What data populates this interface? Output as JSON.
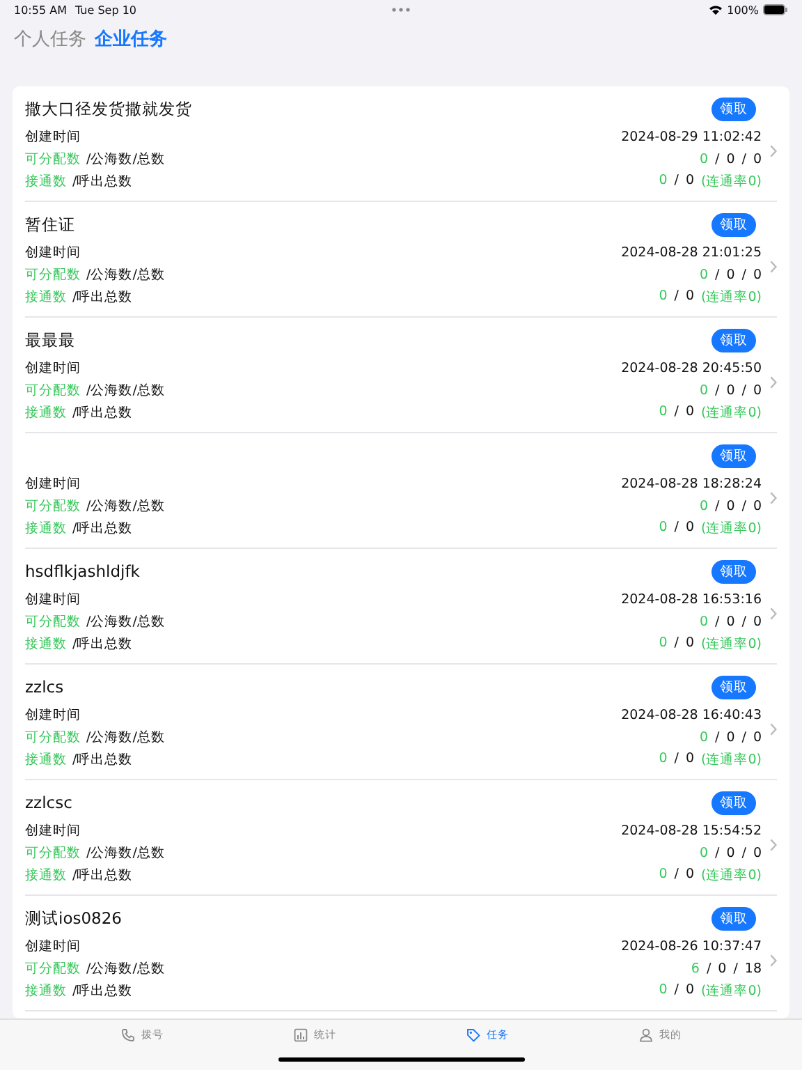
{
  "status_bar": {
    "time": "10:55 AM",
    "date": "Tue Sep 10",
    "battery": "100%"
  },
  "tabs": [
    {
      "label": "个人任务",
      "selected": false
    },
    {
      "label": "企业任务",
      "selected": true
    }
  ],
  "tasks": [
    {
      "title": "撒大口径发货撒就发货",
      "button": "领取",
      "created_label": "创建时间",
      "created_at": "2024-08-29 11:02:42",
      "assign_label": "可分配数",
      "assign_rest": "/公海数/总数",
      "counts": [
        {
          "text": "0",
          "kind": "accent"
        },
        {
          "text": "/",
          "kind": "plain"
        },
        {
          "text": "0",
          "kind": "plain"
        },
        {
          "text": "/",
          "kind": "plain"
        },
        {
          "text": "0",
          "kind": "plain"
        }
      ],
      "connect_label": "接通数",
      "connect_rest": "/呼出总数",
      "calls": [
        {
          "text": "0",
          "kind": "accent"
        },
        {
          "text": "/",
          "kind": "plain"
        },
        {
          "text": "0",
          "kind": "plain"
        },
        {
          "text": "(连通率0)",
          "kind": "accent"
        }
      ]
    },
    {
      "title": "暂住证",
      "button": "领取",
      "created_label": "创建时间",
      "created_at": "2024-08-28 21:01:25",
      "assign_label": "可分配数",
      "assign_rest": "/公海数/总数",
      "counts": [
        {
          "text": "0",
          "kind": "accent"
        },
        {
          "text": "/",
          "kind": "plain"
        },
        {
          "text": "0",
          "kind": "plain"
        },
        {
          "text": "/",
          "kind": "plain"
        },
        {
          "text": "0",
          "kind": "plain"
        }
      ],
      "connect_label": "接通数",
      "connect_rest": "/呼出总数",
      "calls": [
        {
          "text": "0",
          "kind": "accent"
        },
        {
          "text": "/",
          "kind": "plain"
        },
        {
          "text": "0",
          "kind": "plain"
        },
        {
          "text": "(连通率0)",
          "kind": "accent"
        }
      ]
    },
    {
      "title": "最最最",
      "button": "领取",
      "created_label": "创建时间",
      "created_at": "2024-08-28 20:45:50",
      "assign_label": "可分配数",
      "assign_rest": "/公海数/总数",
      "counts": [
        {
          "text": "0",
          "kind": "accent"
        },
        {
          "text": "/",
          "kind": "plain"
        },
        {
          "text": "0",
          "kind": "plain"
        },
        {
          "text": "/",
          "kind": "plain"
        },
        {
          "text": "0",
          "kind": "plain"
        }
      ],
      "connect_label": "接通数",
      "connect_rest": "/呼出总数",
      "calls": [
        {
          "text": "0",
          "kind": "accent"
        },
        {
          "text": "/",
          "kind": "plain"
        },
        {
          "text": "0",
          "kind": "plain"
        },
        {
          "text": "(连通率0)",
          "kind": "accent"
        }
      ]
    },
    {
      "button": "领取",
      "created_label": "创建时间",
      "created_at": "2024-08-28 18:28:24",
      "assign_label": "可分配数",
      "assign_rest": "/公海数/总数",
      "counts": [
        {
          "text": "0",
          "kind": "accent"
        },
        {
          "text": "/",
          "kind": "plain"
        },
        {
          "text": "0",
          "kind": "plain"
        },
        {
          "text": "/",
          "kind": "plain"
        },
        {
          "text": "0",
          "kind": "plain"
        }
      ],
      "connect_label": "接通数",
      "connect_rest": "/呼出总数",
      "calls": [
        {
          "text": "0",
          "kind": "accent"
        },
        {
          "text": "/",
          "kind": "plain"
        },
        {
          "text": "0",
          "kind": "plain"
        },
        {
          "text": "(连通率0)",
          "kind": "accent"
        }
      ]
    },
    {
      "title": "hsdflkjashldjfk",
      "button": "领取",
      "created_label": "创建时间",
      "created_at": "2024-08-28 16:53:16",
      "assign_label": "可分配数",
      "assign_rest": "/公海数/总数",
      "counts": [
        {
          "text": "0",
          "kind": "accent"
        },
        {
          "text": "/",
          "kind": "plain"
        },
        {
          "text": "0",
          "kind": "plain"
        },
        {
          "text": "/",
          "kind": "plain"
        },
        {
          "text": "0",
          "kind": "plain"
        }
      ],
      "connect_label": "接通数",
      "connect_rest": "/呼出总数",
      "calls": [
        {
          "text": "0",
          "kind": "accent"
        },
        {
          "text": "/",
          "kind": "plain"
        },
        {
          "text": "0",
          "kind": "plain"
        },
        {
          "text": "(连通率0)",
          "kind": "accent"
        }
      ]
    },
    {
      "title": "zzlcs",
      "button": "领取",
      "created_label": "创建时间",
      "created_at": "2024-08-28 16:40:43",
      "assign_label": "可分配数",
      "assign_rest": "/公海数/总数",
      "counts": [
        {
          "text": "0",
          "kind": "accent"
        },
        {
          "text": "/",
          "kind": "plain"
        },
        {
          "text": "0",
          "kind": "plain"
        },
        {
          "text": "/",
          "kind": "plain"
        },
        {
          "text": "0",
          "kind": "plain"
        }
      ],
      "connect_label": "接通数",
      "connect_rest": "/呼出总数",
      "calls": [
        {
          "text": "0",
          "kind": "accent"
        },
        {
          "text": "/",
          "kind": "plain"
        },
        {
          "text": "0",
          "kind": "plain"
        },
        {
          "text": "(连通率0)",
          "kind": "accent"
        }
      ]
    },
    {
      "title": "zzlcsc",
      "button": "领取",
      "created_label": "创建时间",
      "created_at": "2024-08-28 15:54:52",
      "assign_label": "可分配数",
      "assign_rest": "/公海数/总数",
      "counts": [
        {
          "text": "0",
          "kind": "accent"
        },
        {
          "text": "/",
          "kind": "plain"
        },
        {
          "text": "0",
          "kind": "plain"
        },
        {
          "text": "/",
          "kind": "plain"
        },
        {
          "text": "0",
          "kind": "plain"
        }
      ],
      "connect_label": "接通数",
      "connect_rest": "/呼出总数",
      "calls": [
        {
          "text": "0",
          "kind": "accent"
        },
        {
          "text": "/",
          "kind": "plain"
        },
        {
          "text": "0",
          "kind": "plain"
        },
        {
          "text": "(连通率0)",
          "kind": "accent"
        }
      ]
    },
    {
      "title": "测试ios0826",
      "button": "领取",
      "created_label": "创建时间",
      "created_at": "2024-08-26 10:37:47",
      "assign_label": "可分配数",
      "assign_rest": "/公海数/总数",
      "counts": [
        {
          "text": "6",
          "kind": "accent"
        },
        {
          "text": "/",
          "kind": "plain"
        },
        {
          "text": "0",
          "kind": "plain"
        },
        {
          "text": "/",
          "kind": "plain"
        },
        {
          "text": "18",
          "kind": "plain"
        }
      ],
      "connect_label": "接通数",
      "connect_rest": "/呼出总数",
      "calls": [
        {
          "text": "0",
          "kind": "accent"
        },
        {
          "text": "/",
          "kind": "plain"
        },
        {
          "text": "0",
          "kind": "plain"
        },
        {
          "text": "(连通率0)",
          "kind": "accent"
        }
      ]
    }
  ],
  "tab_bar": [
    {
      "label": "拨号",
      "kind": "phone",
      "selected": false
    },
    {
      "label": "统计",
      "kind": "chart",
      "selected": false
    },
    {
      "label": "任务",
      "kind": "tag",
      "selected": true
    },
    {
      "label": "我的",
      "kind": "person",
      "selected": false
    }
  ]
}
